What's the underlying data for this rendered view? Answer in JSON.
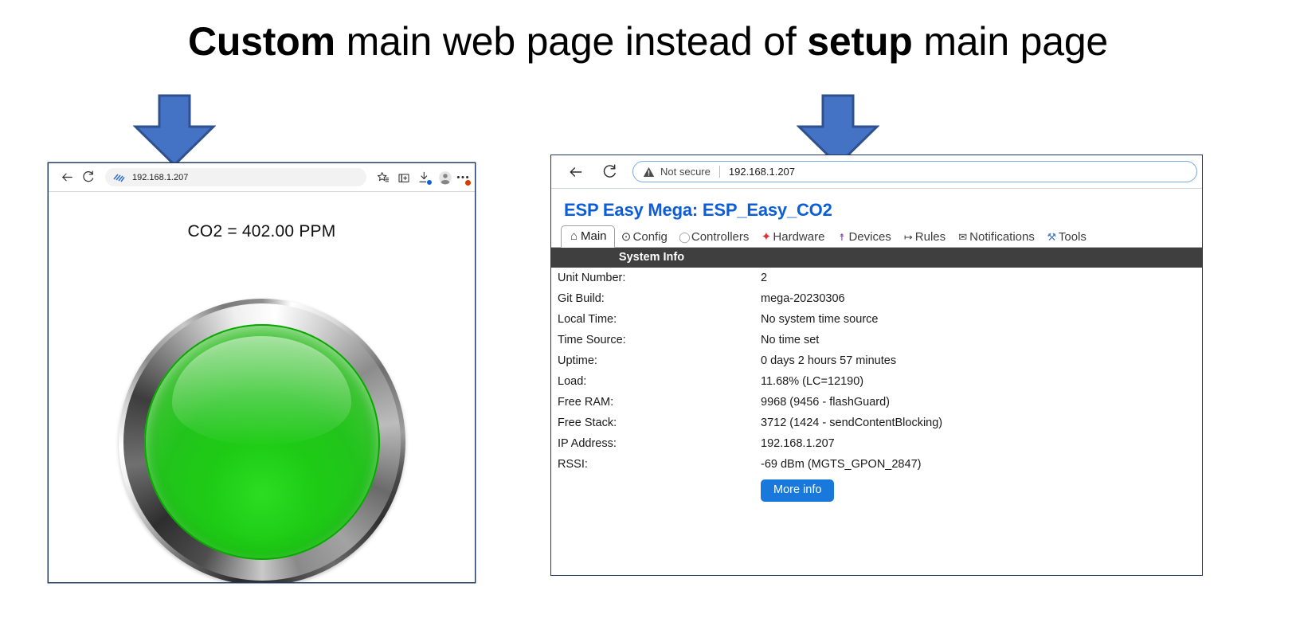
{
  "slide": {
    "title_part1": "Custom",
    "title_part2": " main web page instead of ",
    "title_part3": "setup",
    "title_part4": " main page",
    "arrow_color": "#4472C4",
    "arrow_border_color": "#2F528F"
  },
  "left_browser": {
    "toolbar": {
      "back_label": "Back",
      "reload_label": "Refresh",
      "url": "192.168.1.207",
      "favorite_label": "Add this page to favorites",
      "collections_label": "Collections",
      "downloads_label": "Downloads",
      "profile_label": "Profile",
      "more_label": "Settings and more"
    },
    "page": {
      "readout": "CO2 = 402.00 PPM",
      "lamp_state": "green",
      "lamp_color": "#1ecb15"
    }
  },
  "right_browser": {
    "toolbar": {
      "back_label": "Back",
      "reload_label": "Refresh",
      "security_label": "Not secure",
      "url": "192.168.1.207"
    },
    "page": {
      "header": "ESP Easy Mega: ESP_Easy_CO2",
      "header_color": "#0b5ed7",
      "tabs": [
        {
          "label": "Main",
          "icon": "home-icon",
          "glyph": "⌂",
          "icon_color": "#3c3c3c",
          "active": true
        },
        {
          "label": "Config",
          "icon": "gear-icon",
          "glyph": "⊙",
          "icon_color": "#3c3c3c",
          "active": false
        },
        {
          "label": "Controllers",
          "icon": "speech-bubble-icon",
          "glyph": "◯",
          "icon_color": "#9a9a9a",
          "active": false
        },
        {
          "label": "Hardware",
          "icon": "pushpin-icon",
          "glyph": "✦",
          "icon_color": "#e03131",
          "active": false
        },
        {
          "label": "Devices",
          "icon": "plug-icon",
          "glyph": "☨",
          "icon_color": "#7b3fa0",
          "active": false
        },
        {
          "label": "Rules",
          "icon": "arrow-right-icon",
          "glyph": "↦",
          "icon_color": "#3c3c3c",
          "active": false
        },
        {
          "label": "Notifications",
          "icon": "envelope-icon",
          "glyph": "✉",
          "icon_color": "#3c3c3c",
          "active": false
        },
        {
          "label": "Tools",
          "icon": "wrench-icon",
          "glyph": "⚒",
          "icon_color": "#4a7bbf",
          "active": false
        }
      ],
      "section_title": "System Info",
      "rows": [
        {
          "key": "Unit Number:",
          "value": "2",
          "alert": false
        },
        {
          "key": "Git Build:",
          "value": "mega-20230306",
          "alert": false
        },
        {
          "key": "Local Time:",
          "value": "No system time source",
          "alert": true
        },
        {
          "key": "Time Source:",
          "value": "No time set",
          "alert": false
        },
        {
          "key": "Uptime:",
          "value": "0 days 2 hours 57 minutes",
          "alert": false
        },
        {
          "key": "Load:",
          "value": "11.68% (LC=12190)",
          "alert": false
        },
        {
          "key": "Free RAM:",
          "value": "9968 (9456 - flashGuard)",
          "alert": false
        },
        {
          "key": "Free Stack:",
          "value": "3712 (1424 - sendContentBlocking)",
          "alert": false
        },
        {
          "key": "IP Address:",
          "value": "192.168.1.207",
          "alert": false
        },
        {
          "key": "RSSI:",
          "value": "-69 dBm (MGTS_GPON_2847)",
          "alert": false
        }
      ],
      "more_info_button": "More info",
      "button_color": "#1878dc",
      "alert_color": "#e8100e"
    }
  }
}
